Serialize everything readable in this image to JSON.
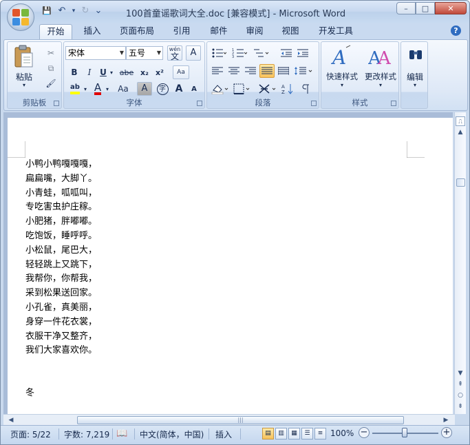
{
  "window": {
    "title": "100首童谣歌词大全.doc [兼容模式] - Microsoft Word",
    "controls": {
      "minimize": "–",
      "maximize": "□",
      "close": "✕"
    }
  },
  "qat": {
    "save": "💾",
    "undo": "↶",
    "undo_drop": "▾",
    "redo": "↻",
    "customize": "⌄"
  },
  "tabs": [
    "开始",
    "插入",
    "页面布局",
    "引用",
    "邮件",
    "审阅",
    "视图",
    "开发工具"
  ],
  "help": "?",
  "ribbon": {
    "clipboard": {
      "label": "剪贴板",
      "paste": "粘贴",
      "cut": "✂",
      "copy": "⧉",
      "format_painter": "🖌"
    },
    "font": {
      "label": "字体",
      "font_name": "宋体",
      "font_size": "五号",
      "phonetic": "wén",
      "phonetic_char": "文",
      "char_border": "A",
      "bold": "B",
      "italic": "I",
      "underline": "U",
      "strike": "abe",
      "sub": "x₂",
      "sup": "x²",
      "clear": "Aa",
      "change_case": "Aa",
      "char_shading": "A",
      "enclose": "字",
      "grow": "A",
      "shrink": "A",
      "highlight": "ab",
      "font_color": "A"
    },
    "paragraph": {
      "label": "段落"
    },
    "styles": {
      "label": "样式",
      "quick": "快速样式",
      "change": "更改样式"
    },
    "editing": {
      "label": "编辑"
    }
  },
  "document": {
    "lines": [
      "小鸭小鸭嘎嘎嘎，",
      "扁扁嘴，大脚丫。",
      "小青蛙，呱呱叫，",
      "专吃害虫护庄稼。",
      "小肥猪，胖嘟嘟。",
      "吃饱饭，睡呼呼。",
      "小松鼠，尾巴大，",
      "轻轻跳上又跳下，",
      "我帮你，你帮我，",
      "采到松果送回家。",
      "小孔雀，真美丽，",
      "身穿一件花衣裳，",
      "衣服干净又整齐，",
      "我们大家喜欢你。"
    ],
    "next_heading": "冬"
  },
  "status": {
    "page": "页面: 5/22",
    "words": "字数: 7,219",
    "language": "中文(简体，中国)",
    "mode": "插入",
    "zoom": "100%",
    "zoom_level": 1.0
  },
  "colors": {
    "accent": "#2f6cc0",
    "highlight": "#ffff00",
    "font_color": "#e00000"
  }
}
